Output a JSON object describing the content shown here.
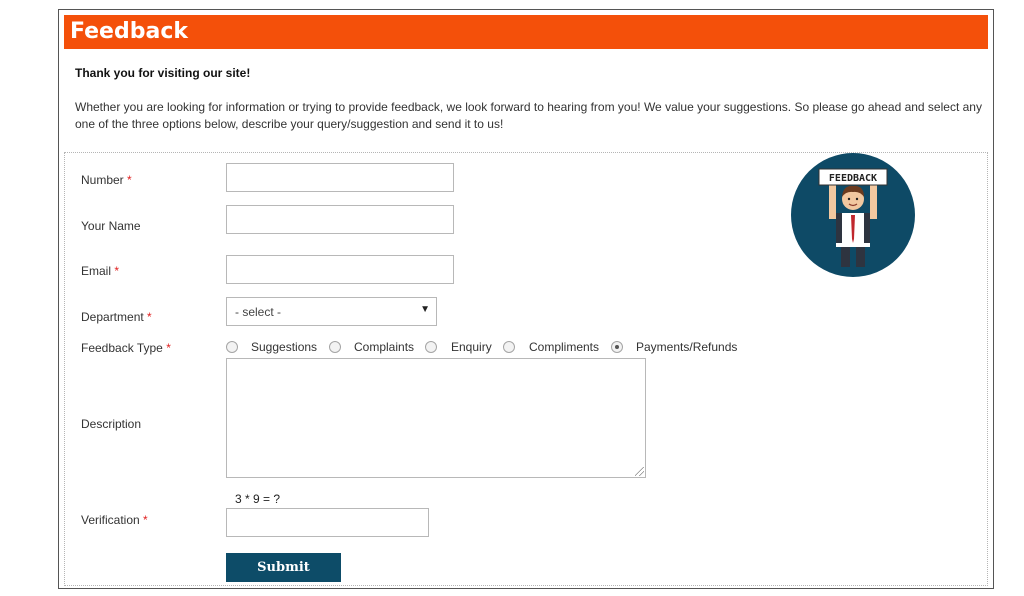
{
  "header": {
    "title": "Feedback"
  },
  "intro": {
    "thanks": "Thank you for visiting our site!",
    "body": "Whether you are looking for information or trying to provide feedback, we look forward to hearing from you! We value your suggestions. So please go ahead and select any one of the three options below, describe your query/suggestion and send it to us!"
  },
  "form": {
    "required_mark": "*",
    "number": {
      "label": "Number",
      "value": ""
    },
    "name": {
      "label": "Your Name",
      "value": ""
    },
    "email": {
      "label": "Email",
      "value": ""
    },
    "department": {
      "label": "Department",
      "selected": "- select -"
    },
    "feedback_type": {
      "label": "Feedback Type",
      "options": [
        {
          "label": "Suggestions",
          "checked": false
        },
        {
          "label": "Complaints",
          "checked": false
        },
        {
          "label": "Enquiry",
          "checked": false
        },
        {
          "label": "Compliments",
          "checked": false
        },
        {
          "label": "Payments/Refunds",
          "checked": true
        }
      ]
    },
    "description": {
      "label": "Description",
      "value": ""
    },
    "verification": {
      "label": "Verification",
      "question": "3 * 9 = ?",
      "value": ""
    },
    "submit_label": "Submit"
  },
  "badge": {
    "sign_text": "FEEDBACK",
    "bg_color": "#0e4a66"
  },
  "colors": {
    "brand": "#f4500a",
    "button": "#0d4c68",
    "required": "#e02020"
  }
}
